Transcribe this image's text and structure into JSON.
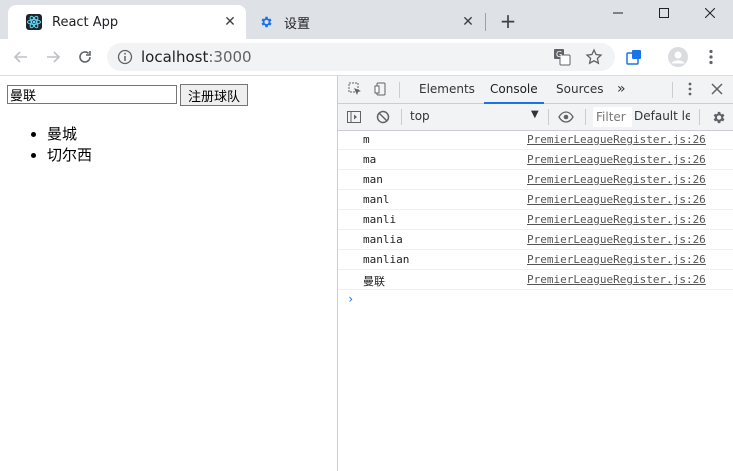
{
  "browser": {
    "tabs": [
      {
        "title": "React App",
        "icon": "react-icon",
        "active": true
      },
      {
        "title": "设置",
        "icon": "gear-icon",
        "active": false
      }
    ],
    "new_tab": "+",
    "url": {
      "host": "localhost",
      "port": ":3000"
    },
    "colors": {
      "tabbar": "#dee1e6",
      "omnibox": "#f1f3f4",
      "accent": "#1a73e8"
    }
  },
  "page": {
    "input_value": "曼联",
    "register_button": "注册球队",
    "teams": [
      "曼城",
      "切尔西"
    ]
  },
  "devtools": {
    "tabs": [
      "Elements",
      "Console",
      "Sources"
    ],
    "more_tabs": "»",
    "context": "top",
    "filter_placeholder": "Filter",
    "levels": "Default lev",
    "logs": [
      {
        "message": "m",
        "source": "PremierLeagueRegister.js:26"
      },
      {
        "message": "ma",
        "source": "PremierLeagueRegister.js:26"
      },
      {
        "message": "man",
        "source": "PremierLeagueRegister.js:26"
      },
      {
        "message": "manl",
        "source": "PremierLeagueRegister.js:26"
      },
      {
        "message": "manli",
        "source": "PremierLeagueRegister.js:26"
      },
      {
        "message": "manlia",
        "source": "PremierLeagueRegister.js:26"
      },
      {
        "message": "manlian",
        "source": "PremierLeagueRegister.js:26"
      },
      {
        "message": "曼联",
        "source": "PremierLeagueRegister.js:26"
      }
    ],
    "prompt": "›"
  }
}
